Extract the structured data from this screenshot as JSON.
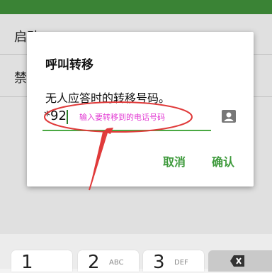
{
  "settings": {
    "row1_label": "启动",
    "row2_label": "禁"
  },
  "dialog": {
    "title": "呼叫转移",
    "message": "无人应答时的转移号码。",
    "input_value": "*92",
    "cancel_label": "取消",
    "confirm_label": "确认",
    "contact_icon": "contact-card-icon"
  },
  "annotation": {
    "text": "输入要转移到的电话号码",
    "color": "#e23bd3",
    "arrow_color": "#e03a3a"
  },
  "keyboard": {
    "keys": [
      {
        "digit": "1",
        "letters": ""
      },
      {
        "digit": "2",
        "letters": "ABC"
      },
      {
        "digit": "3",
        "letters": "DEF"
      }
    ],
    "delete_icon": "backspace-icon"
  },
  "colors": {
    "accent": "#3e9a3c",
    "status_bar": "#3f8f3a"
  }
}
